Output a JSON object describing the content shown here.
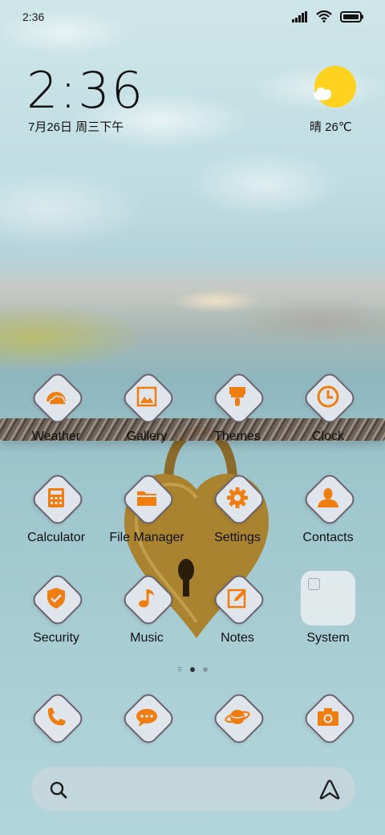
{
  "status_bar": {
    "time": "2:36",
    "icons": [
      "signal-icon",
      "wifi-icon",
      "battery-icon"
    ]
  },
  "clock_widget": {
    "time": "2:36",
    "date": "7月26日 周三下午"
  },
  "weather_widget": {
    "text": "晴 26℃",
    "icon": "sun-cloud-icon"
  },
  "accent_color": "#ef7d10",
  "apps": [
    {
      "label": "Weather",
      "icon": "weather-icon"
    },
    {
      "label": "Gallery",
      "icon": "gallery-icon"
    },
    {
      "label": "Themes",
      "icon": "paintbrush-icon"
    },
    {
      "label": "Clock",
      "icon": "clock-icon"
    },
    {
      "label": "Calculator",
      "icon": "calculator-icon"
    },
    {
      "label": "File Manager",
      "icon": "folder-icon"
    },
    {
      "label": "Settings",
      "icon": "gear-icon"
    },
    {
      "label": "Contacts",
      "icon": "person-icon"
    },
    {
      "label": "Security",
      "icon": "shield-check-icon"
    },
    {
      "label": "Music",
      "icon": "music-note-icon"
    },
    {
      "label": "Notes",
      "icon": "note-pencil-icon"
    },
    {
      "label": "System",
      "icon": "folder-icon"
    }
  ],
  "page_indicator": {
    "pages": 2,
    "current": 1
  },
  "dock": [
    {
      "icon": "phone-icon"
    },
    {
      "icon": "message-icon"
    },
    {
      "icon": "browser-planet-icon"
    },
    {
      "icon": "camera-icon"
    }
  ],
  "search_bar": {
    "left_icon": "search-icon",
    "right_icon": "assistant-icon"
  }
}
